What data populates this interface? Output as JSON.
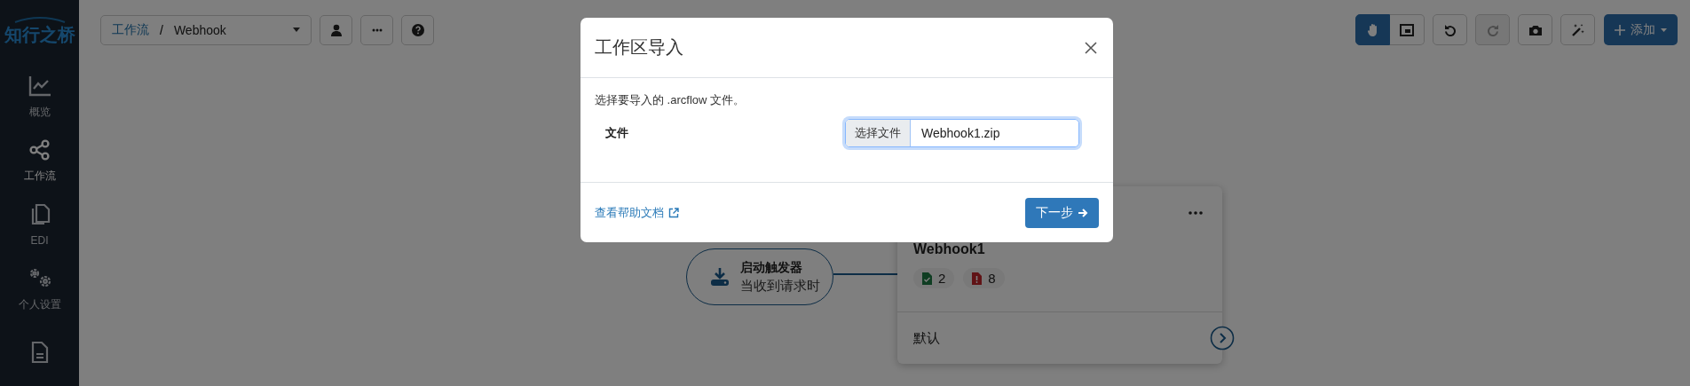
{
  "logo": {
    "text": "知行之桥"
  },
  "sidebar": {
    "items": [
      {
        "kind": "chart",
        "label": "概览",
        "selected": false
      },
      {
        "kind": "share",
        "label": "工作流",
        "selected": true
      },
      {
        "kind": "copy",
        "label": "EDI",
        "selected": false
      },
      {
        "kind": "gears",
        "label": "个人设置",
        "selected": false
      },
      {
        "kind": "document",
        "selected": false
      }
    ]
  },
  "breadcrumb": {
    "parent": "工作流",
    "separator": "/",
    "current": "Webhook"
  },
  "toolbar": {
    "tools": [
      {
        "kind": "hand",
        "selected": true
      },
      {
        "kind": "fit",
        "selected": false
      }
    ],
    "actions": [
      {
        "kind": "undo",
        "disabled": false
      },
      {
        "kind": "redo",
        "disabled": true
      },
      {
        "kind": "camera",
        "disabled": false
      },
      {
        "kind": "wand",
        "disabled": false
      }
    ],
    "add_button": {
      "label": "添加"
    }
  },
  "canvas": {
    "trigger": {
      "title": "启动触发器",
      "subtitle": "当收到请求时"
    },
    "card": {
      "title": "Webhook1",
      "badges": [
        {
          "kind": "success",
          "count": "2"
        },
        {
          "kind": "error",
          "count": "8"
        }
      ],
      "footer": "默认"
    }
  },
  "modal": {
    "title": "工作区导入",
    "description": "选择要导入的 .arcflow 文件。",
    "field_label": "文件",
    "file_button": "选择文件",
    "file_value": "Webhook1.zip",
    "focused": true,
    "help_link": "查看帮助文档",
    "next_button": "下一步"
  }
}
